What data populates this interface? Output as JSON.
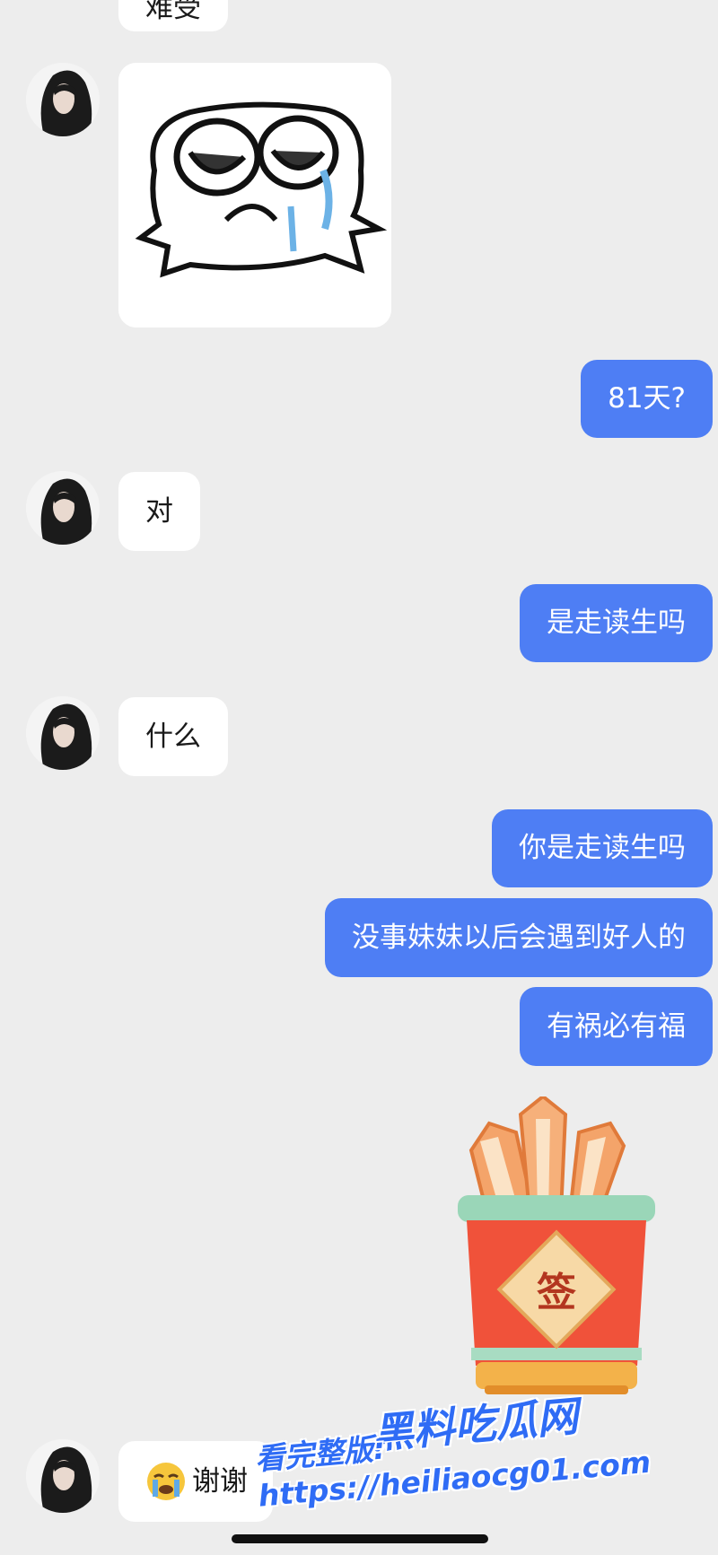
{
  "messages": {
    "m0_partial": "难受",
    "m2": "81天?",
    "m3": "对",
    "m4": "是走读生吗",
    "m5": "什么",
    "m6": "你是走读生吗",
    "m7": "没事妹妹以后会遇到好人的",
    "m8": "有祸必有福",
    "m10": "谢谢"
  },
  "sticker_jar_char": "签",
  "watermark": {
    "brand": "黑料吃瓜网",
    "line": "看完整版: https://heiliaocg01.com"
  },
  "colors": {
    "background": "#ededed",
    "outgoing_bubble": "#4e7ef4",
    "incoming_bubble": "#ffffff"
  },
  "icons": [
    "avatar",
    "crying-sticker",
    "fortune-sticks-sticker",
    "crying-face-emoji"
  ]
}
